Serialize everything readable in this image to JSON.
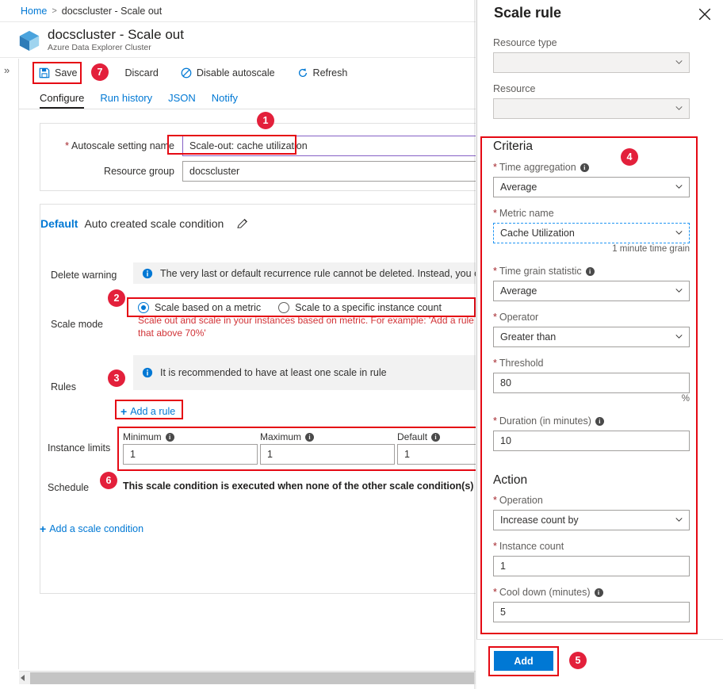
{
  "breadcrumb": {
    "home": "Home",
    "separator": ">",
    "current": "docscluster - Scale out"
  },
  "header": {
    "title": "docscluster - Scale out",
    "subtitle": "Azure Data Explorer Cluster",
    "icon": "cube-icon"
  },
  "commandbar": {
    "save": "Save",
    "discard": "Discard",
    "disable_autoscale": "Disable autoscale",
    "refresh": "Refresh"
  },
  "tabs": [
    {
      "label": "Configure",
      "active": true
    },
    {
      "label": "Run history",
      "active": false
    },
    {
      "label": "JSON",
      "active": false
    },
    {
      "label": "Notify",
      "active": false
    }
  ],
  "settings_card": {
    "name_label": "Autoscale setting name",
    "name_value": "Scale-out: cache utilization",
    "rg_label": "Resource group",
    "rg_value": "docscluster"
  },
  "condition": {
    "default_tag": "Default",
    "description": "Auto created scale condition",
    "edit_icon": "pencil-icon",
    "delete_warning_label": "Delete warning",
    "delete_warning_text": "The very last or default recurrence rule cannot be deleted. Instead, you can di",
    "scale_mode_label": "Scale mode",
    "scale_mode_options": [
      {
        "label": "Scale based on a metric",
        "selected": true
      },
      {
        "label": "Scale to a specific instance count",
        "selected": false
      }
    ],
    "scale_mode_help": "Scale out and scale in your instances based on metric. For example: 'Add a rule that above 70%'",
    "rules_label": "Rules",
    "rules_info": "It is recommended to have at least one scale in rule",
    "add_rule_label": "Add a rule",
    "instance_limits_label": "Instance limits",
    "limits": [
      {
        "caption": "Minimum",
        "value": "1"
      },
      {
        "caption": "Maximum",
        "value": "1"
      },
      {
        "caption": "Default",
        "value": "1"
      }
    ],
    "schedule_label": "Schedule",
    "schedule_text": "This scale condition is executed when none of the other scale condition(s) mat"
  },
  "add_scale_condition_label": "Add a scale condition",
  "blade": {
    "title": "Scale rule",
    "close_icon": "close-icon",
    "resource_type": {
      "label": "Resource type",
      "value": "",
      "disabled": true
    },
    "resource": {
      "label": "Resource",
      "value": "",
      "disabled": true
    },
    "criteria": {
      "heading": "Criteria",
      "time_aggregation": {
        "label": "Time aggregation",
        "value": "Average",
        "required": true,
        "info": true
      },
      "metric_name": {
        "label": "Metric name",
        "value": "Cache Utilization",
        "required": true,
        "focused": true
      },
      "time_grain_note": "1 minute time grain",
      "time_grain_statistic": {
        "label": "Time grain statistic",
        "value": "Average",
        "required": true,
        "info": true
      },
      "operator": {
        "label": "Operator",
        "value": "Greater than",
        "required": true
      },
      "threshold": {
        "label": "Threshold",
        "value": "80",
        "required": true,
        "suffix": "%"
      },
      "duration": {
        "label": "Duration (in minutes)",
        "value": "10",
        "required": true,
        "info": true
      }
    },
    "action": {
      "heading": "Action",
      "operation": {
        "label": "Operation",
        "value": "Increase count by",
        "required": true
      },
      "instance_count": {
        "label": "Instance count",
        "value": "1",
        "required": true
      },
      "cool_down": {
        "label": "Cool down (minutes)",
        "value": "5",
        "required": true,
        "info": true
      }
    },
    "add_button": "Add"
  },
  "badges": [
    {
      "n": "1"
    },
    {
      "n": "2"
    },
    {
      "n": "3"
    },
    {
      "n": "4"
    },
    {
      "n": "5"
    },
    {
      "n": "6"
    },
    {
      "n": "7"
    }
  ],
  "colors": {
    "accent": "#0078d4",
    "highlight": "#e50914",
    "badge": "#e3203b",
    "required": "#a4262c",
    "help": "#d13438",
    "purple_border": "#8661c5"
  }
}
